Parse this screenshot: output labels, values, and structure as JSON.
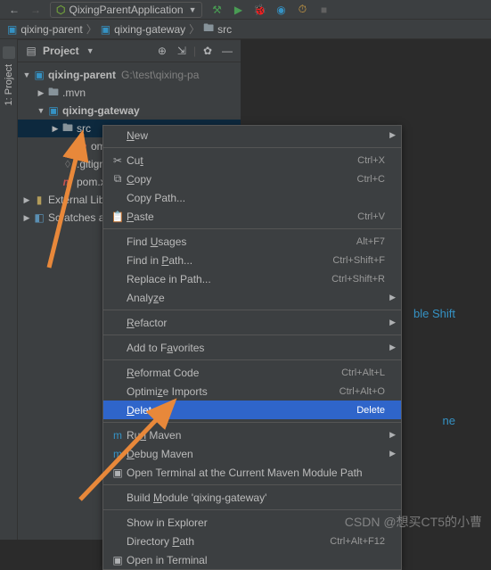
{
  "toolbar": {
    "run_config": "QixingParentApplication"
  },
  "breadcrumb": {
    "items": [
      "qixing-parent",
      "qixing-gateway",
      "src"
    ]
  },
  "left_tab": "1: Project",
  "panel": {
    "title": "Project"
  },
  "tree": {
    "root": {
      "label": "qixing-parent",
      "tail": "G:\\test\\qixing-pa"
    },
    "mvn": ".mvn",
    "gateway": "qixing-gateway",
    "src": "src",
    "pom_inner": "om.",
    "gitignore": ".gitignor",
    "pom_outer": "pom.xm",
    "ext_libs": "External Lib",
    "scratches": "Scratches a"
  },
  "menu": {
    "new": "New",
    "cut": "Cut",
    "cut_k": "Ctrl+X",
    "copy": "Copy",
    "copy_k": "Ctrl+C",
    "copy_path": "Copy Path...",
    "paste": "Paste",
    "paste_k": "Ctrl+V",
    "find_usages": "Find Usages",
    "find_usages_k": "Alt+F7",
    "find_in_path": "Find in Path...",
    "find_in_path_k": "Ctrl+Shift+F",
    "replace_in_path": "Replace in Path...",
    "replace_in_path_k": "Ctrl+Shift+R",
    "analyze": "Analyze",
    "refactor": "Refactor",
    "add_fav": "Add to Favorites",
    "reformat": "Reformat Code",
    "reformat_k": "Ctrl+Alt+L",
    "optimize": "Optimize Imports",
    "optimize_k": "Ctrl+Alt+O",
    "delete": "Delete...",
    "delete_k": "Delete",
    "run_maven": "Run Maven",
    "debug_maven": "Debug Maven",
    "open_term_maven": "Open Terminal at the Current Maven Module Path",
    "build_module": "Build Module 'qixing-gateway'",
    "show_explorer": "Show in Explorer",
    "dir_path": "Directory Path",
    "dir_path_k": "Ctrl+Alt+F12",
    "open_term": "Open in Terminal"
  },
  "hints": {
    "dbl_shift": "ble Shift",
    "ne": "ne"
  },
  "watermark": "CSDN @想买CT5的小曹"
}
